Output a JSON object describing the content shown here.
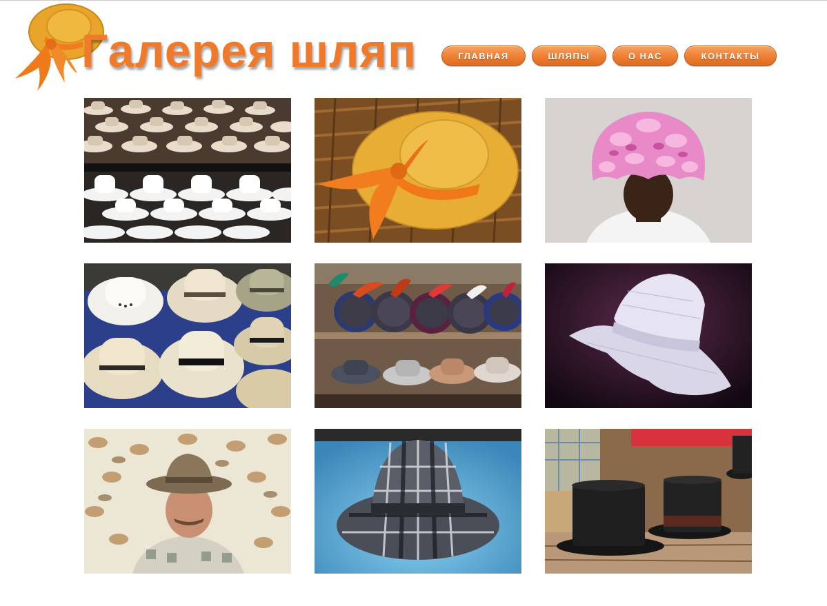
{
  "site": {
    "title": "Галерея шляп",
    "logo_icon": "straw-hat-with-orange-bow-icon",
    "brand_color": "#f07a2a"
  },
  "nav": {
    "items": [
      {
        "label": "ГЛАВНАЯ"
      },
      {
        "label": "ШЛЯПЫ"
      },
      {
        "label": "О НАС"
      },
      {
        "label": "КОНТАКТЫ"
      }
    ]
  },
  "gallery": {
    "photos": [
      {
        "subject": "white-hats-on-shelves"
      },
      {
        "subject": "straw-hat-orange-bow"
      },
      {
        "subject": "pink-fur-hat"
      },
      {
        "subject": "panama-hats-pile"
      },
      {
        "subject": "feathered-hats-market"
      },
      {
        "subject": "white-wide-brim-hat"
      },
      {
        "subject": "man-in-tweed-fedora"
      },
      {
        "subject": "plaid-fedora"
      },
      {
        "subject": "black-top-hats"
      }
    ]
  }
}
